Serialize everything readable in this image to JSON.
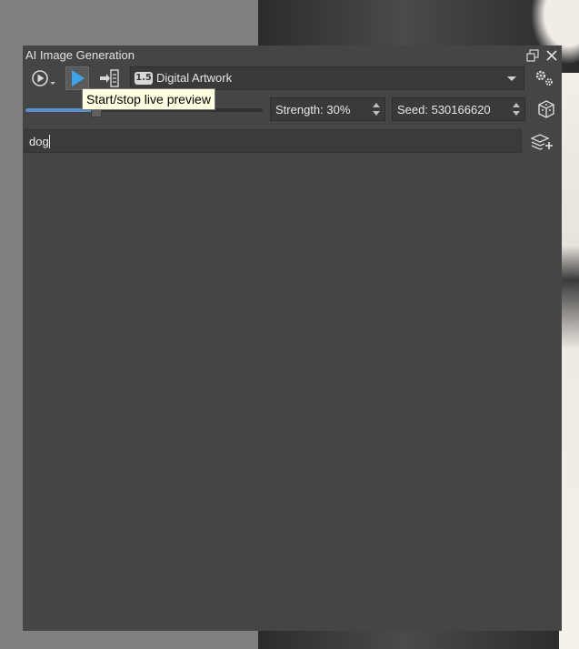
{
  "panel": {
    "title": "AI Image Generation"
  },
  "toolbar": {
    "style_badge": "1.5",
    "style_label": "Digital Artwork"
  },
  "controls": {
    "strength_label": "Strength: 30%",
    "strength_value": 0.3,
    "seed_label": "Seed: 530166620"
  },
  "prompt": {
    "value": "dog"
  },
  "tooltip": {
    "text": "Start/stop live preview"
  },
  "icons": {
    "mode": "play-circle-icon",
    "play": "play-icon",
    "queue": "queue-icon",
    "settings": "gears-icon",
    "seed": "dice-icon",
    "add_region": "layers-add-icon",
    "float": "float-window-icon",
    "close": "close-icon"
  },
  "colors": {
    "accent": "#5a8fcf",
    "play": "#3fa3e8",
    "panel_bg": "#454545",
    "tooltip_bg": "#ffffe1"
  }
}
